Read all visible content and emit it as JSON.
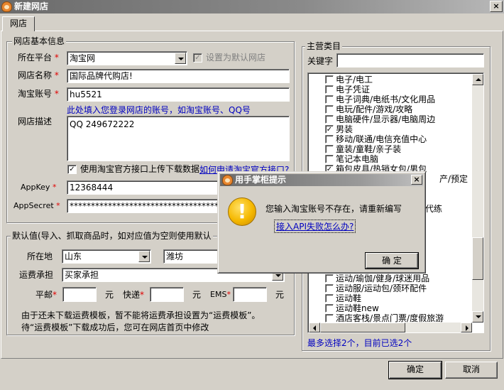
{
  "window": {
    "title": "新建网店",
    "close_glyph": "×"
  },
  "tab": {
    "label": "网店"
  },
  "basic": {
    "legend": "网店基本信息",
    "platform_label": "所在平台",
    "platform_value": "淘宝网",
    "default_label": "设置为默认网店",
    "name_label": "网店名称",
    "name_value": "国际品牌代购店!",
    "account_label": "淘宝账号",
    "account_value": "hu5521",
    "account_hint": "此处填入您登录网店的账号，如淘宝账号、QQ号",
    "desc_label": "网店描述",
    "desc_value": "QQ 249672222",
    "api_check_label": "使用淘宝官方接口上传下载数据",
    "api_link": "如何申请淘宝官方接口?",
    "appkey_label": "AppKey",
    "appkey_value": "12368444",
    "appsecret_label": "AppSecret",
    "appsecret_value": "********************************************"
  },
  "defaults": {
    "legend": "默认值(导入、抓取商品时，如对应值为空则使用默认",
    "location_label": "所在地",
    "province": "山东",
    "city": "潍坊",
    "freight_label": "运费承担",
    "freight_value": "买家承担",
    "mail_label": "平邮",
    "express_label": "快递",
    "ems_label": "EMS",
    "unit": "元",
    "note1": "由于还未下载运费模板，暂不能将运费承担设置为“运费模板”。",
    "note2": "待“运费模板”下载成功后，您可在网店首页中修改"
  },
  "category": {
    "legend": "主营类目",
    "keyword_label": "关键字",
    "items": [
      {
        "label": "电子/电工",
        "checked": false
      },
      {
        "label": "电子凭证",
        "checked": false
      },
      {
        "label": "电子词典/电纸书/文化用品",
        "checked": false
      },
      {
        "label": "电玩/配件/游戏/攻略",
        "checked": false
      },
      {
        "label": "电脑硬件/显示器/电脑周边",
        "checked": false
      },
      {
        "label": "男装",
        "checked": true
      },
      {
        "label": "移动/联通/电信充值中心",
        "checked": false
      },
      {
        "label": "童装/童鞋/亲子装",
        "checked": false
      },
      {
        "label": "笔记本电脑",
        "checked": false
      },
      {
        "label": "箱包皮具/热销女包/男包",
        "checked": true
      },
      {
        "label": "运动/瑜伽/健身/球迷用品",
        "checked": false
      },
      {
        "label": "运动服/运动包/颈环配件",
        "checked": false
      },
      {
        "label": "运动鞋",
        "checked": false
      },
      {
        "label": "运动鞋new",
        "checked": false
      },
      {
        "label": "酒店客栈/景点门票/度假旅游",
        "checked": false
      }
    ],
    "hidden_fragment_1": "产/预定",
    "hidden_fragment_2": "代练",
    "status": "最多选择2个，目前已选2个"
  },
  "dialog": {
    "title": "用手掌柜提示",
    "message": "您输入淘宝账号不存在，请重新编写",
    "link": "接入API失败怎么办?",
    "ok": "确 定",
    "icon_glyph": "!"
  },
  "footer": {
    "ok": "确定",
    "cancel": "取消"
  }
}
